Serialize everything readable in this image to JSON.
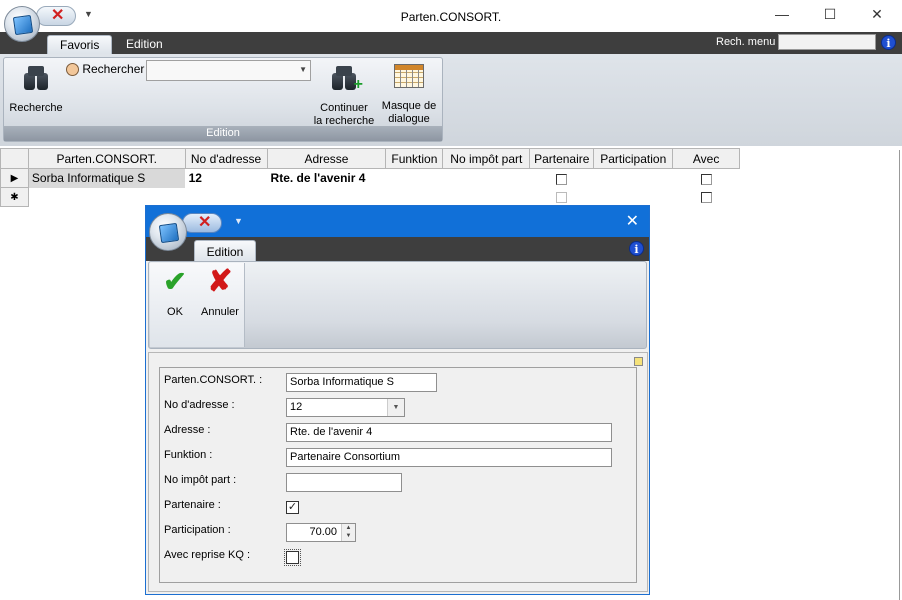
{
  "window": {
    "title": "Parten.CONSORT.",
    "minimize": "—",
    "maximize": "☐",
    "close": "✕"
  },
  "ribbon": {
    "tabs": [
      "Favoris",
      "Edition"
    ],
    "search_menu_label": "Rech. menu",
    "group_label": "Edition",
    "recherche_label": "Recherche",
    "rechercher_label": "Rechercher",
    "continuer_label_1": "Continuer",
    "continuer_label_2": "la recherche",
    "masque_label_1": "Masque de",
    "masque_label_2": "dialogue"
  },
  "grid": {
    "columns": [
      "Parten.CONSORT.",
      "No d'adresse",
      "Adresse",
      "Funktion",
      "No impôt part",
      "Partenaire",
      "Participation",
      "Avec"
    ],
    "rows": [
      {
        "parten": "Sorba Informatique S",
        "no_adresse": "12",
        "adresse": "Rte. de l'avenir 4",
        "funktion": "",
        "no_impot": "",
        "partenaire": false,
        "participation": "",
        "avec": false
      }
    ],
    "current_marker": "▶",
    "new_marker": "✱"
  },
  "dialog": {
    "tab": "Edition",
    "ok_label": "OK",
    "annuler_label": "Annuler",
    "fields": {
      "parten_label": "Parten.CONSORT. :",
      "parten_value": "Sorba Informatique S",
      "no_adresse_label": "No d'adresse :",
      "no_adresse_value": "12",
      "adresse_label": "Adresse :",
      "adresse_value": "Rte. de l'avenir 4",
      "funktion_label": "Funktion :",
      "funktion_value": "Partenaire Consortium",
      "no_impot_label": "No impôt part :",
      "no_impot_value": "",
      "partenaire_label": "Partenaire :",
      "partenaire_checked": true,
      "participation_label": "Participation :",
      "participation_value": "70.00",
      "avec_label": "Avec reprise KQ :",
      "avec_checked": false
    }
  },
  "colors": {
    "dialog_title": "#1170d8",
    "tabstrip": "#3e3e3e",
    "info": "#1f4fd1"
  }
}
